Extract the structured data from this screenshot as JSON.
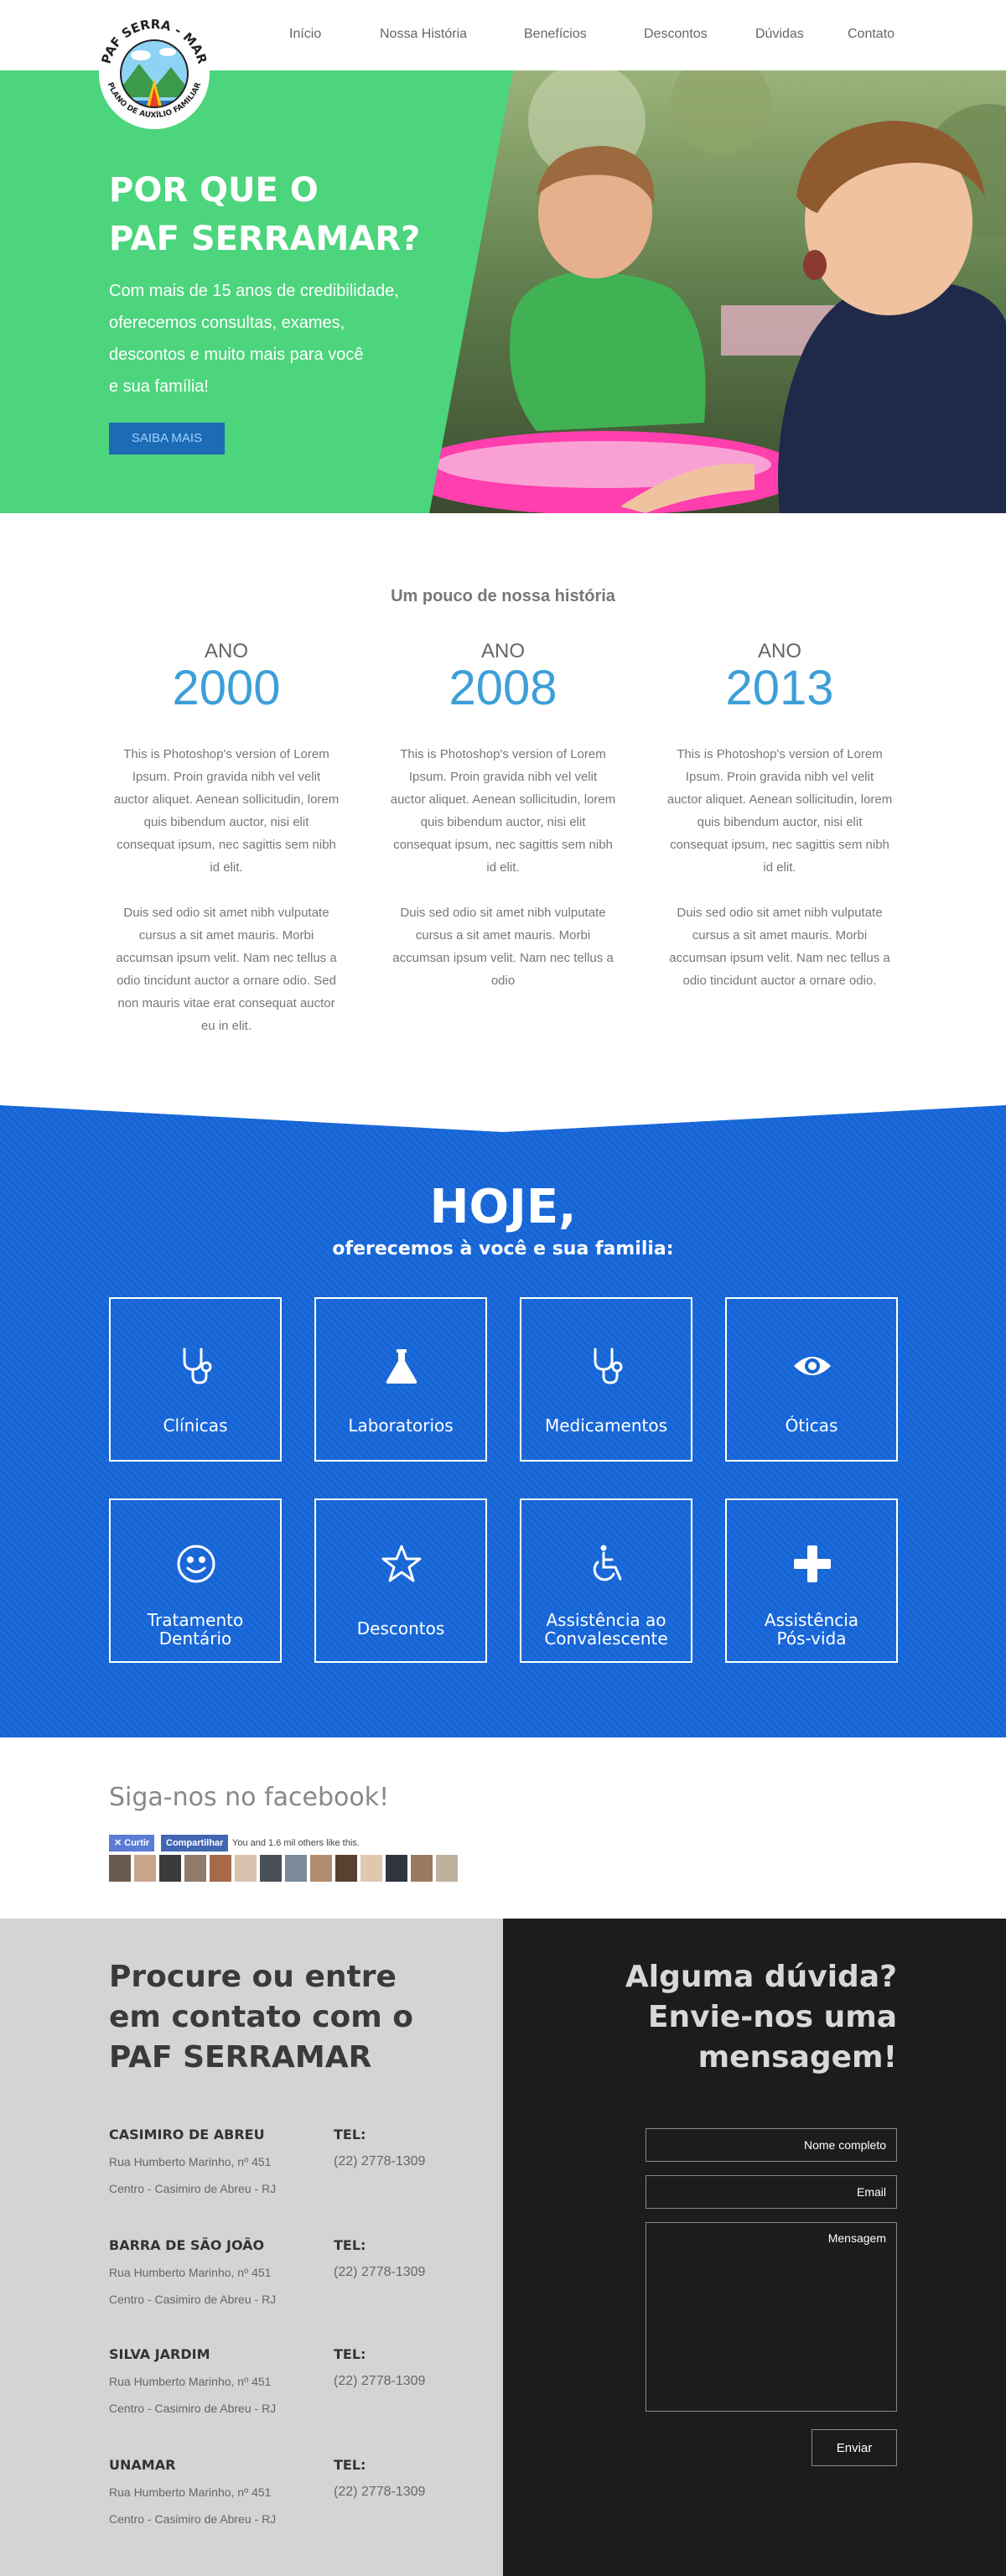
{
  "nav": {
    "items": [
      {
        "label": "Início"
      },
      {
        "label": "Nossa História"
      },
      {
        "label": "Benefícios"
      },
      {
        "label": "Descontos"
      },
      {
        "label": "Dúvidas"
      },
      {
        "label": "Contato"
      }
    ]
  },
  "logo": {
    "top_text": "PAF SERRA - MAR",
    "bottom_text": "PLANO DE AUXÍLIO FAMILIAR"
  },
  "hero": {
    "title_line1": "POR QUE O",
    "title_line2": "PAF SERRAMAR?",
    "sub_line1": "Com mais de 15 anos de credibilidade,",
    "sub_line2": "oferecemos consultas, exames,",
    "sub_line3": "descontos e muito mais para você",
    "sub_line4": "e sua família!",
    "button": "SAIBA MAIS",
    "green": "#4cd57c"
  },
  "history": {
    "title": "Um pouco de nossa história",
    "years": [
      {
        "label": "ANO",
        "year": "2000",
        "p1": "This is Photoshop's version  of Lorem Ipsum. Proin gravida nibh vel velit auctor aliquet. Aenean sollicitudin, lorem quis bibendum auctor, nisi elit consequat ipsum, nec sagittis sem nibh id elit.",
        "p2": "Duis sed odio sit amet nibh vulputate cursus a sit amet mauris. Morbi accumsan ipsum velit. Nam nec tellus a odio tincidunt auctor a ornare odio. Sed non  mauris vitae erat consequat auctor eu in elit."
      },
      {
        "label": "ANO",
        "year": "2008",
        "p1": "This is Photoshop's version  of Lorem Ipsum. Proin gravida nibh vel velit auctor aliquet. Aenean sollicitudin, lorem quis bibendum auctor, nisi elit consequat ipsum, nec sagittis sem nibh id elit.",
        "p2": "Duis sed odio sit amet nibh vulputate cursus a sit amet mauris. Morbi accumsan ipsum velit. Nam nec tellus a odio"
      },
      {
        "label": "ANO",
        "year": "2013",
        "p1": "This is Photoshop's version  of Lorem Ipsum. Proin gravida nibh vel velit auctor aliquet. Aenean sollicitudin, lorem quis bibendum auctor, nisi elit consequat ipsum, nec sagittis sem nibh id elit.",
        "p2": "Duis sed odio sit amet nibh vulputate cursus a sit amet mauris. Morbi accumsan ipsum velit. Nam nec tellus a odio tincidunt auctor a ornare odio."
      }
    ]
  },
  "hoje": {
    "title": "HOJE,",
    "subtitle": "oferecemos à você e sua familia:",
    "blue": "#1565d7",
    "cards": [
      {
        "line1": "Clínicas",
        "line2": "",
        "icon": "stethoscope-icon"
      },
      {
        "line1": "Laboratorios",
        "line2": "",
        "icon": "flask-icon"
      },
      {
        "line1": "Medicamentos",
        "line2": "",
        "icon": "stethoscope-icon"
      },
      {
        "line1": "Óticas",
        "line2": "",
        "icon": "eye-icon"
      },
      {
        "line1": "Tratamento",
        "line2": "Dentário",
        "icon": "smiley-icon"
      },
      {
        "line1": "Descontos",
        "line2": "",
        "icon": "star-icon"
      },
      {
        "line1": "Assistência ao",
        "line2": "Convalescente",
        "icon": "wheelchair-icon"
      },
      {
        "line1": "Assistência",
        "line2": "Pós-vida",
        "icon": "plus-icon"
      }
    ]
  },
  "facebook": {
    "title": "Siga-nos no facebook!",
    "like_button": "✕ Curtir",
    "share_button": "Compartilhar",
    "like_text": "You and 1.6 mil others like this."
  },
  "contact": {
    "title_line1": "Procure ou entre",
    "title_line2": "em contato com o",
    "title_line3": "PAF SERRAMAR",
    "offices": [
      {
        "name": "CASIMIRO DE ABREU",
        "address": "Rua Humberto Marinho, nº 451",
        "city": "Centro - Casimiro de Abreu - RJ",
        "tel_label": "TEL:",
        "tel": "(22) 2778-1309"
      },
      {
        "name": "BARRA DE SÃO JOÃO",
        "address": "Rua Humberto Marinho, nº 451",
        "city": "Centro - Casimiro de Abreu - RJ",
        "tel_label": "TEL:",
        "tel": "(22) 2778-1309"
      },
      {
        "name": "SILVA JARDIM",
        "address": "Rua Humberto Marinho, nº 451",
        "city": "Centro - Casimiro de Abreu - RJ",
        "tel_label": "TEL:",
        "tel": "(22) 2778-1309"
      },
      {
        "name": "UNAMAR",
        "address": "Rua Humberto Marinho, nº 451",
        "city": "Centro - Casimiro de Abreu - RJ",
        "tel_label": "TEL:",
        "tel": "(22) 2778-1309"
      }
    ],
    "form_title_line1": "Alguma dúvida?",
    "form_title_line2": "Envie-nos uma",
    "form_title_line3": "mensagem!",
    "name_placeholder": "Nome completo",
    "email_placeholder": "Email",
    "message_placeholder": "Mensagem",
    "send_button": "Enviar"
  }
}
